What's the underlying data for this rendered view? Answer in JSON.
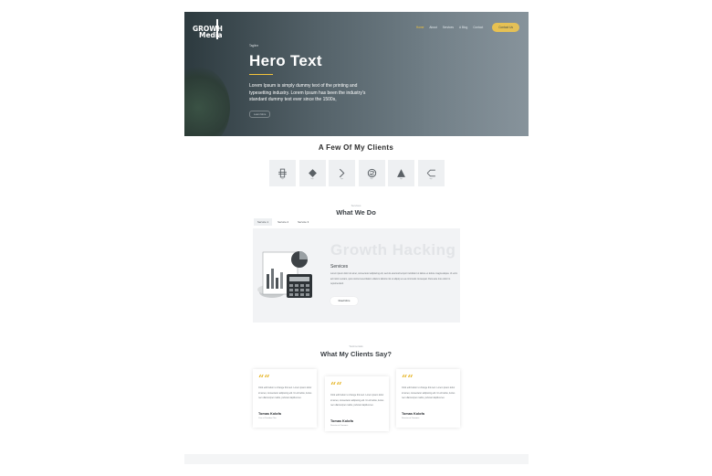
{
  "header": {
    "logo_line1": "GROWH",
    "logo_line2": "Media",
    "nav": [
      {
        "label": "Home",
        "active": true
      },
      {
        "label": "About",
        "active": false
      },
      {
        "label": "Services",
        "active": false
      },
      {
        "label": "A Blog",
        "active": false
      },
      {
        "label": "Contact",
        "active": false
      }
    ],
    "cta": "Contact Us"
  },
  "hero": {
    "tagline": "Tagline",
    "title": "Hero Text",
    "description": "Lorem Ipsum is simply dummy text of the printing and typesetting industry. Lorem Ipsum has been the industry's standard dummy text ever since the 1500s,",
    "button": "Learn More"
  },
  "clients": {
    "title": "A Few Of My Clients",
    "logos": [
      {
        "icon": "grid-logo-icon",
        "caption": "logo"
      },
      {
        "icon": "diamond-logo-icon",
        "caption": "logo"
      },
      {
        "icon": "chevron-logo-icon",
        "caption": "logo"
      },
      {
        "icon": "s-ring-logo-icon",
        "caption": "logo"
      },
      {
        "icon": "triangle-logo-icon",
        "caption": "logo"
      },
      {
        "icon": "bracket-logo-icon",
        "caption": "logo"
      }
    ]
  },
  "services": {
    "kicker": "Services",
    "title": "What We Do",
    "tabs": [
      {
        "label": "Service 1",
        "active": true
      },
      {
        "label": "Service 2",
        "active": false
      },
      {
        "label": "Service 3",
        "active": false
      }
    ],
    "panel": {
      "heading": "Growth Hacking",
      "subheading": "Services",
      "body": "Lorem ipsum dolor sit amet, consectetur adipiscing elit, sed do eiusmod tempor incididunt ut labore et dolore magna aliqua. Ut enim ad minim veniam, quis nostrud exercitation ullamco laboris nisi ut aliquip ex ea commodo consequat. Duis aute irure dolor in reprehenderit",
      "button": "Read More"
    }
  },
  "testimonials": {
    "kicker": "Testimonials",
    "title": "What My Clients Say?",
    "items": [
      {
        "text": "Click edit button to change this text. Lorem ipsum dolor sit amet, consectetur adipiscing elit. Ut elit tellus, luctus nec ullamcorper mattis, pulvinar dapibus leo.",
        "name": "Tomas Kolofa",
        "role": "Ceo at Youtube Cba"
      },
      {
        "text": "Click edit button to change this text. Lorem ipsum dolor sit amet, consectetur adipiscing elit. Ut elit tellus, luctus nec ullamcorper mattis, pulvinar dapibus leo.",
        "name": "Tomas Kolofa",
        "role": "Director at Dunamis"
      },
      {
        "text": "Click edit button to change this text. Lorem ipsum dolor sit amet, consectetur adipiscing elit. Ut elit tellus, luctus nec ullamcorper mattis, pulvinar dapibus leo.",
        "name": "Tomas Kolofa",
        "role": "Director at Dunamis"
      }
    ]
  },
  "colors": {
    "accent": "#f5c43b",
    "quote": "#e7b82f"
  }
}
